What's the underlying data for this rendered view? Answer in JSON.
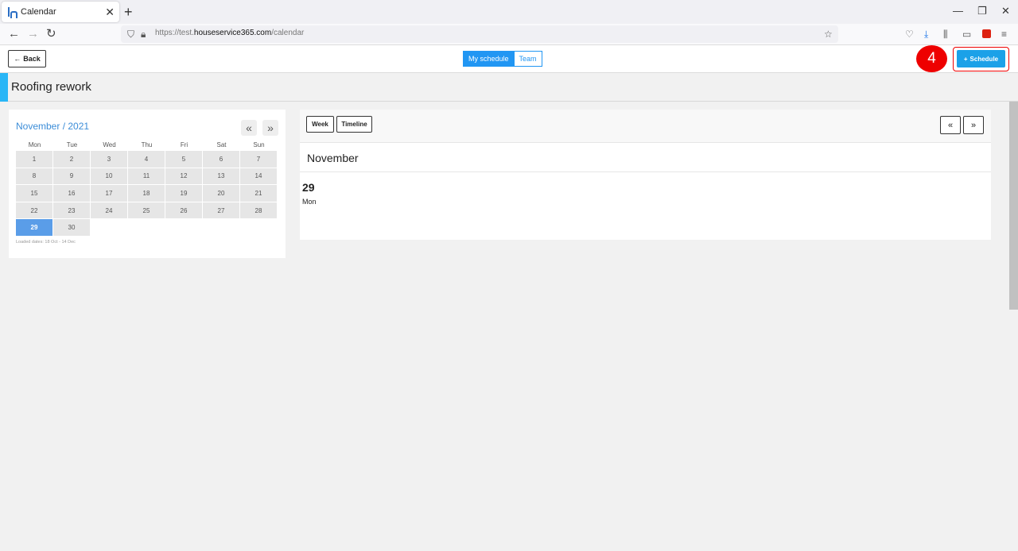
{
  "browser": {
    "tab_title": "Calendar",
    "tab_close": "✕",
    "new_tab": "+",
    "url_prefix": "https://test.",
    "url_domain": "houseservice365.com",
    "url_path": "/calendar",
    "window_controls": {
      "minimize": "—",
      "restore": "❐",
      "close": "✕"
    }
  },
  "header": {
    "back_label": "Back",
    "back_arrow": "←",
    "segments": [
      {
        "label": "My schedule",
        "active": true
      },
      {
        "label": "Team",
        "active": false
      }
    ],
    "step_badge": "4",
    "schedule_plus": "+",
    "schedule_label": "Schedule"
  },
  "page": {
    "title": "Roofing rework",
    "accent_color": "#29b6f6"
  },
  "mini_calendar": {
    "month_label": "November / 2021",
    "prev": "«",
    "next": "»",
    "weekdays": [
      "Mon",
      "Tue",
      "Wed",
      "Thu",
      "Fri",
      "Sat",
      "Sun"
    ],
    "days": [
      "1",
      "2",
      "3",
      "4",
      "5",
      "6",
      "7",
      "8",
      "9",
      "10",
      "11",
      "12",
      "13",
      "14",
      "15",
      "16",
      "17",
      "18",
      "19",
      "20",
      "21",
      "22",
      "23",
      "24",
      "25",
      "26",
      "27",
      "28",
      "29",
      "30"
    ],
    "selected_day": "29",
    "loaded_dates": "Loaded dates: 18 Oct - 14 Dec"
  },
  "main": {
    "view_week": "Week",
    "view_timeline": "Timeline",
    "prev": "«",
    "next": "»",
    "month": "November",
    "day_number": "29",
    "day_name": "Mon"
  }
}
